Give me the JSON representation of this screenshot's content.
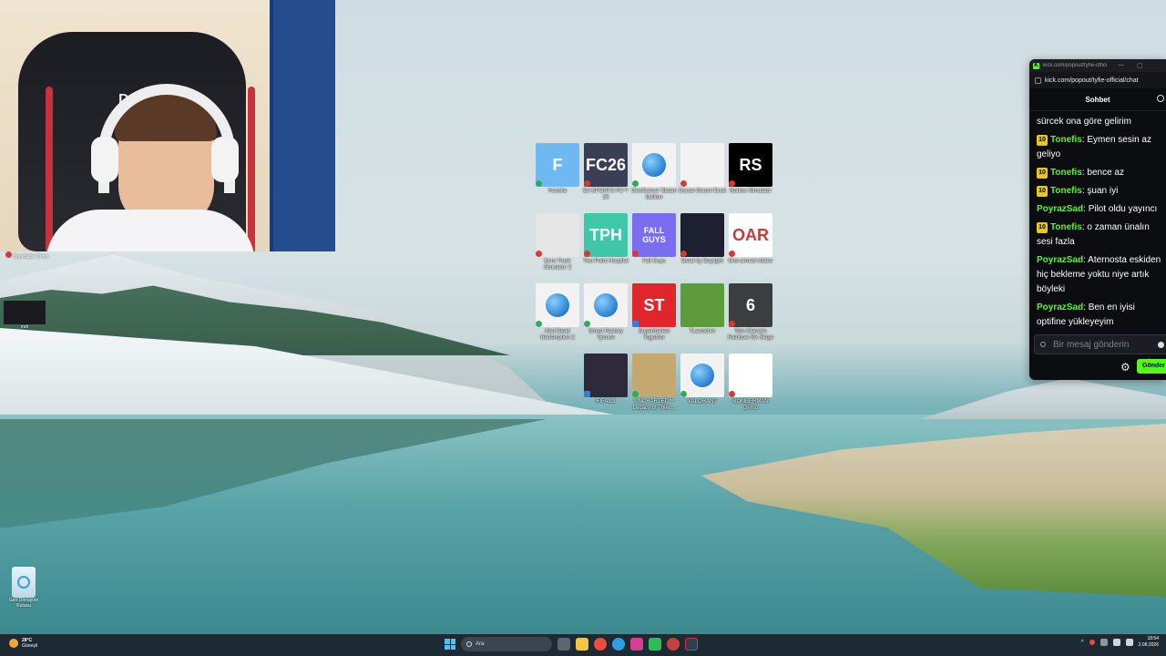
{
  "desktop": {
    "recycle_bin_label": "Geri Dönüşüm\nKutusu",
    "left_items": [
      {
        "label": "Bopl Battle Demo"
      },
      {
        "label": "mdr"
      }
    ],
    "icons": [
      {
        "label": "Fortnite",
        "tile_text": "F",
        "bg": "#6fb8f2",
        "badge": "ok"
      },
      {
        "label": "EA SPORTS FC™ 26",
        "tile_text": "FC26",
        "bg": "#3a3f56",
        "badge": "x"
      },
      {
        "label": "GeoGuessr Steam\nEdition",
        "tile_text": "",
        "bg": "#f2f2f2",
        "badge": "ok"
      },
      {
        "label": "Goose Goose Duck",
        "tile_text": "",
        "bg": "#f2f2f2",
        "badge": "x"
      },
      {
        "label": "Roblox Simulator",
        "tile_text": "RS",
        "bg": "#000000",
        "badge": "x"
      },
      {
        "label": "Euro Truck\nSimulator 2",
        "tile_text": "",
        "bg": "#e6e6e6",
        "badge": "x"
      },
      {
        "label": "Two Point Hospital",
        "tile_text": "TPH",
        "bg": "#3fc7a8",
        "badge": "x"
      },
      {
        "label": "Fall Guys",
        "tile_text": "FALL GUYS",
        "bg": "#7a6df0",
        "badge": "x"
      },
      {
        "label": "Dead by Daylight",
        "tile_text": "",
        "bg": "#1d2030",
        "badge": "x"
      },
      {
        "label": "One-armed robber",
        "tile_text": "OAR",
        "bg": "#ffffff",
        "badge": "x"
      },
      {
        "label": "Red Dead\nRedemption 2",
        "tile_text": "",
        "bg": "#f2f2f2",
        "badge": "ok"
      },
      {
        "label": "Smart Factory\nTycoon",
        "tile_text": "",
        "bg": "#f2f2f2",
        "badge": "ok"
      },
      {
        "label": "Supermarket\nTogether",
        "tile_text": "ST",
        "bg": "#e0262a",
        "badge": "sc"
      },
      {
        "label": "TLauncher",
        "tile_text": "",
        "bg": "#5e9b3a",
        "badge": "none"
      },
      {
        "label": "Tom Clancy's\nRainbow Six Siege",
        "tile_text": "6",
        "bg": "#3b3d3f",
        "badge": "x"
      },
      {
        "label": "FIFA 23",
        "tile_text": "",
        "bg": "#2e2a3b",
        "badge": "sc"
      },
      {
        "label": "UNCHARTED™\nLegacy of Thiev...",
        "tile_text": "",
        "bg": "#c5a870",
        "badge": "ok"
      },
      {
        "label": "VALORANT",
        "tile_text": "",
        "bg": "#f2f2f2",
        "badge": "ok"
      },
      {
        "label": "BOMBERMAN\nDemo",
        "tile_text": "",
        "bg": "#ffffff",
        "badge": "x"
      }
    ]
  },
  "webcam": {
    "chair_logo": "DRIVE"
  },
  "chat": {
    "titlebar_text": "kick.com/popout/tyfie-offici...",
    "url": "kick.com/popout/tyfie-official/chat",
    "tab_label": "Sohbet",
    "first_line": "sürcek ona göre gelirim",
    "messages": [
      {
        "sub": "10",
        "user": "Tonefis",
        "color": "#53fc18",
        "text": ": Eymen sesin az geliyo"
      },
      {
        "sub": "10",
        "user": "Tonefis",
        "color": "#53fc18",
        "text": ": bence az"
      },
      {
        "sub": "10",
        "user": "Tonefis",
        "color": "#53fc18",
        "text": ": şuan iyi"
      },
      {
        "sub": "",
        "user": "PoyrazSad",
        "color": "#53fc18",
        "text": ": Pilot oldu yayıncı"
      },
      {
        "sub": "10",
        "user": "Tonefis",
        "color": "#53fc18",
        "text": ": o zaman ünalın sesi fazla"
      },
      {
        "sub": "",
        "user": "PoyrazSad",
        "color": "#53fc18",
        "text": ": Aternosta eskiden hiç bekleme yoktu niye artık böyleki"
      },
      {
        "sub": "",
        "user": "PoyrazSad",
        "color": "#53fc18",
        "text": ": Ben en iyisi optifine yükleyeyim"
      }
    ],
    "input_placeholder": "Bir mesaj gönderin",
    "send_label": "Gönder"
  },
  "taskbar": {
    "weather_temp": "28°C",
    "weather_desc": "Güneşli",
    "search_placeholder": "Ara",
    "time": "18:54",
    "date": "2.08.2026"
  }
}
